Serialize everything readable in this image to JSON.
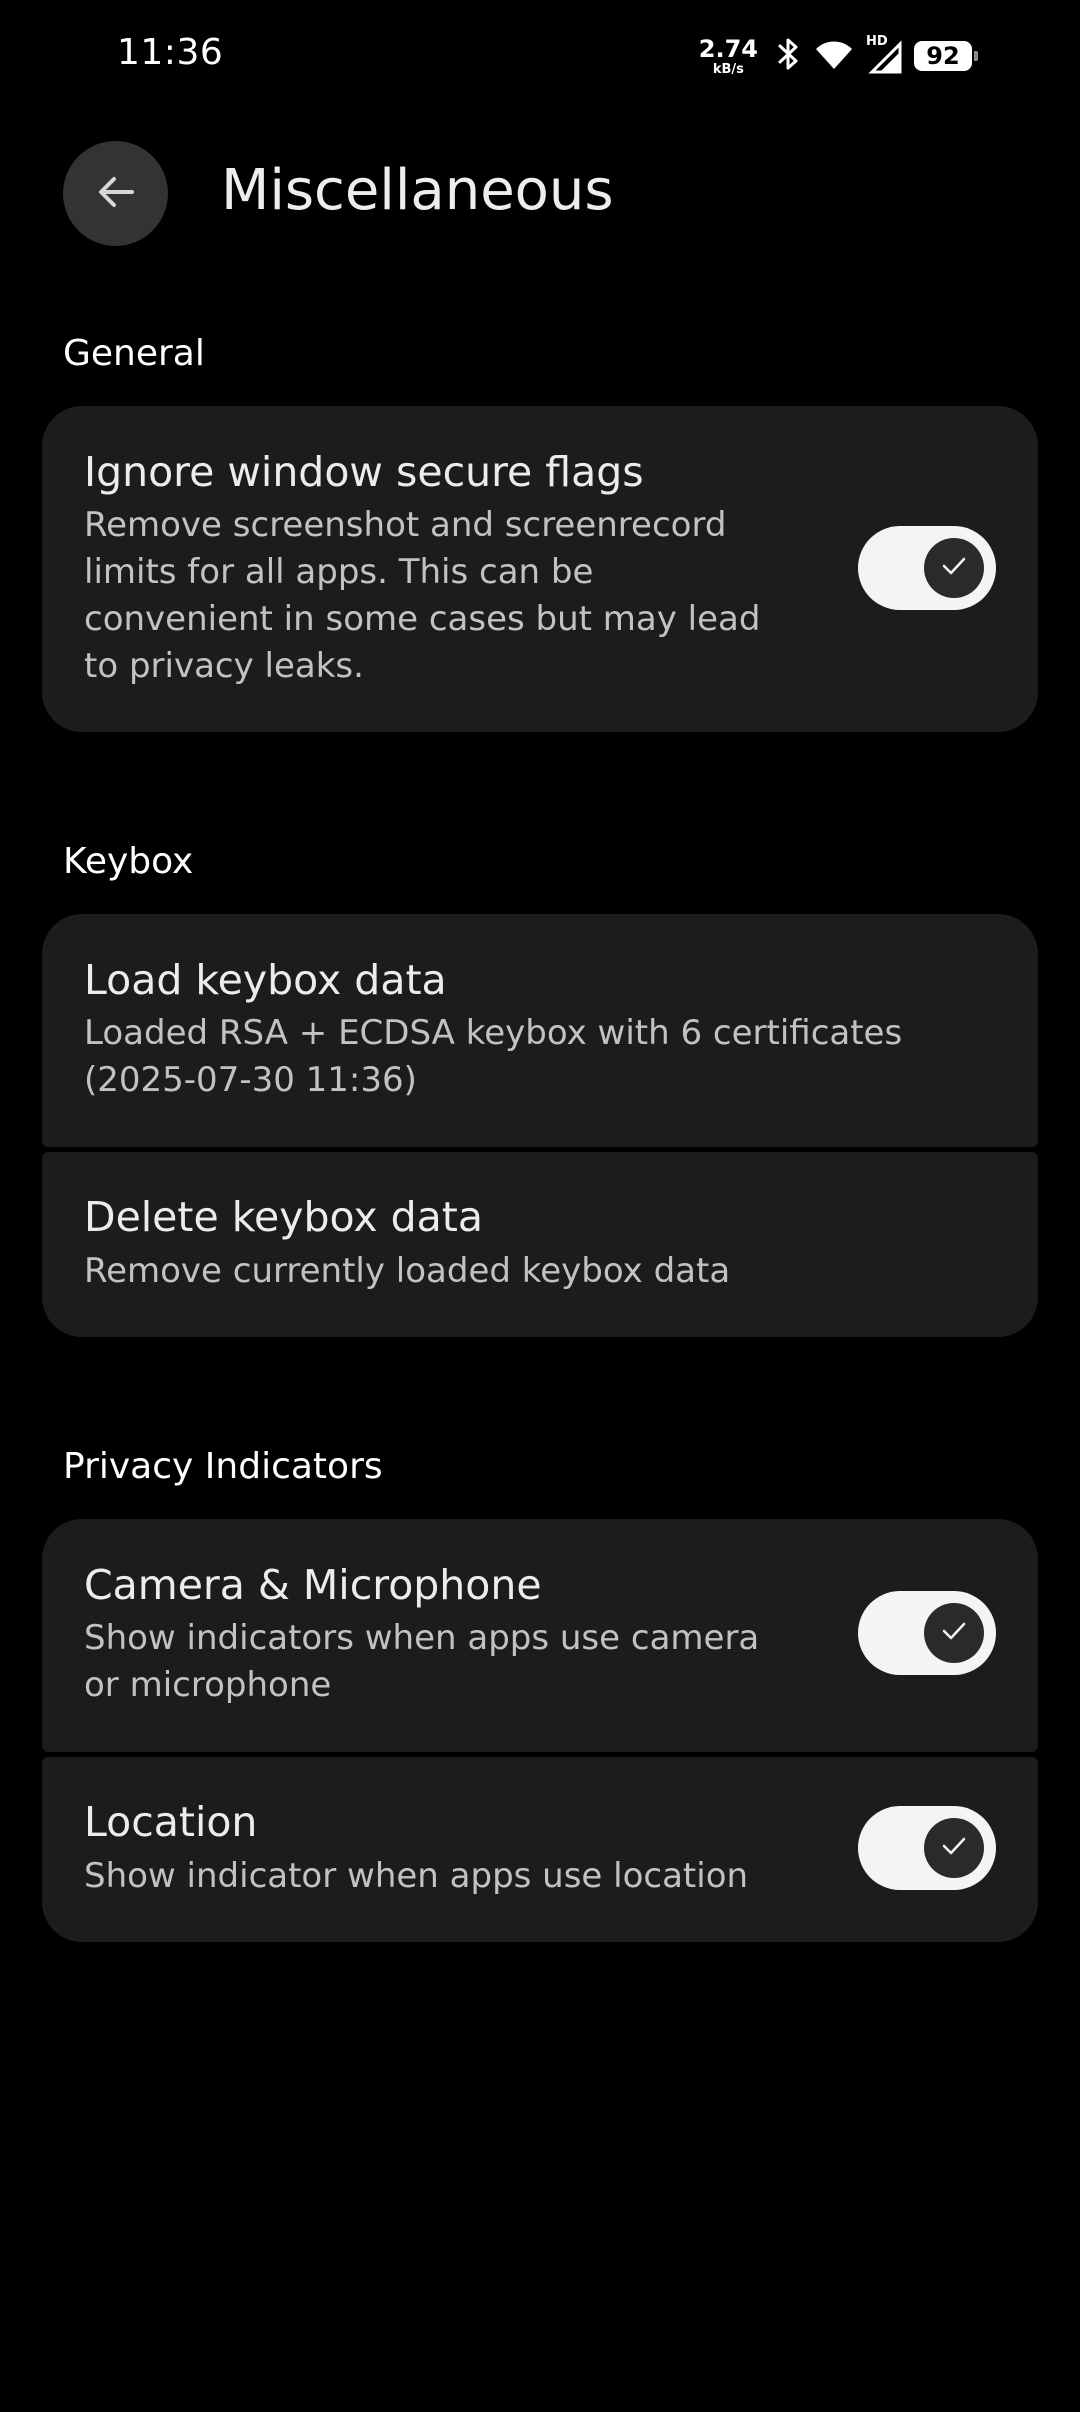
{
  "status_bar": {
    "time": "11:36",
    "net_speed_value": "2.74",
    "net_speed_unit": "kB/s",
    "battery_level": "92",
    "signal_label": "HD"
  },
  "header": {
    "title": "Miscellaneous"
  },
  "sections": {
    "general": {
      "title": "General",
      "items": [
        {
          "title": "Ignore window secure flags",
          "description_lines": [
            "Remove screenshot and screenrecord",
            "limits for all apps. This can be",
            "convenient in some cases but may lead",
            "to privacy leaks."
          ],
          "enabled": true
        }
      ]
    },
    "keybox": {
      "title": "Keybox",
      "items": [
        {
          "title": "Load keybox data",
          "description_lines": [
            "Loaded RSA + ECDSA keybox with 6 certificates",
            "(2025-07-30 11:36)"
          ]
        },
        {
          "title": "Delete keybox data",
          "description_lines": [
            "Remove currently loaded keybox data"
          ]
        }
      ]
    },
    "privacy": {
      "title": "Privacy Indicators",
      "items": [
        {
          "title": "Camera & Microphone",
          "description_lines": [
            "Show indicators when apps use camera",
            "or microphone"
          ],
          "enabled": true
        },
        {
          "title": "Location",
          "description_lines": [
            "Show indicator when apps use location"
          ],
          "enabled": true
        }
      ]
    }
  },
  "icons": {
    "back": "arrow-left-icon",
    "toggle_on": "check-icon",
    "bluetooth": "bluetooth-icon",
    "wifi": "wifi-icon",
    "signal": "cellular-signal-icon"
  },
  "colors": {
    "background": "#000000",
    "card": "#1C1C1C",
    "toggle_track_on": "#F4F4F4",
    "toggle_knob": "#2A2A2A"
  }
}
